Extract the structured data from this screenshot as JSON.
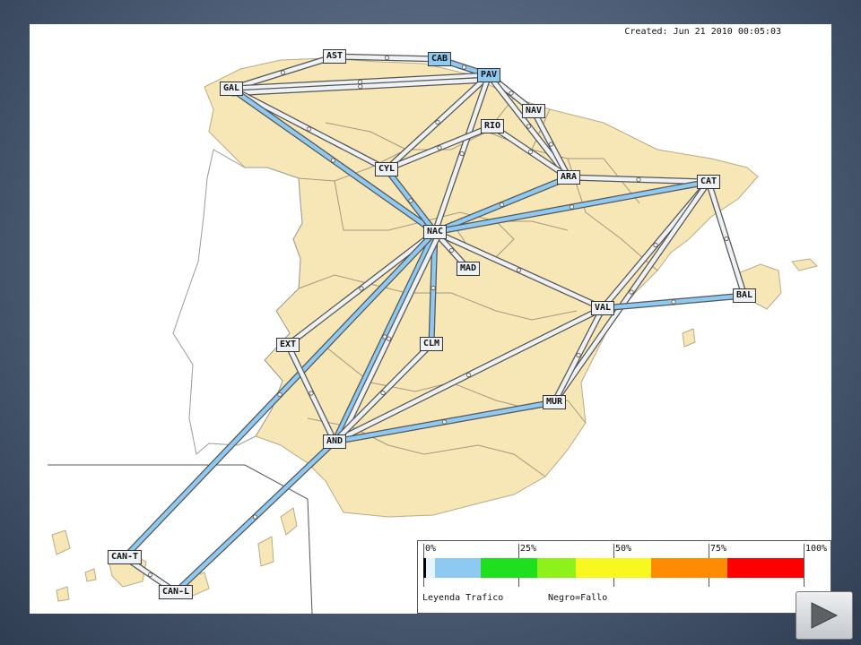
{
  "created": "Created: Jun 21 2010 00:05:03",
  "colors": {
    "land": "#f7e6b6",
    "portugal": "#ffffff",
    "link_low": "#eef2f4",
    "link_high": "#8ec9f2",
    "outline": "#333333"
  },
  "nodes": [
    {
      "id": "AST",
      "label": "AST",
      "style": "gray"
    },
    {
      "id": "CAB",
      "label": "CAB",
      "style": "blue"
    },
    {
      "id": "PAV",
      "label": "PAV",
      "style": "blue"
    },
    {
      "id": "GAL",
      "label": "GAL",
      "style": "gray"
    },
    {
      "id": "NAV",
      "label": "NAV",
      "style": "gray"
    },
    {
      "id": "RIO",
      "label": "RIO",
      "style": "gray"
    },
    {
      "id": "CYL",
      "label": "CYL",
      "style": "gray"
    },
    {
      "id": "ARA",
      "label": "ARA",
      "style": "gray"
    },
    {
      "id": "CAT",
      "label": "CAT",
      "style": "gray"
    },
    {
      "id": "NAC",
      "label": "NAC",
      "style": "gray"
    },
    {
      "id": "MAD",
      "label": "MAD",
      "style": "gray"
    },
    {
      "id": "BAL",
      "label": "BAL",
      "style": "gray"
    },
    {
      "id": "VAL",
      "label": "VAL",
      "style": "gray"
    },
    {
      "id": "EXT",
      "label": "EXT",
      "style": "gray"
    },
    {
      "id": "CLM",
      "label": "CLM",
      "style": "gray"
    },
    {
      "id": "MUR",
      "label": "MUR",
      "style": "gray"
    },
    {
      "id": "AND",
      "label": "AND",
      "style": "gray"
    },
    {
      "id": "CANT",
      "label": "CAN-T",
      "style": "gray"
    },
    {
      "id": "CANL",
      "label": "CAN-L",
      "style": "gray"
    }
  ],
  "links": [
    {
      "from": "GAL",
      "to": "AST",
      "load": "low"
    },
    {
      "from": "AST",
      "to": "CAB",
      "load": "low"
    },
    {
      "from": "CAB",
      "to": "PAV",
      "load": "high"
    },
    {
      "from": "GAL",
      "to": "PAV",
      "load": "low"
    },
    {
      "from": "GAL",
      "to": "PAV",
      "load": "low",
      "bend": 1
    },
    {
      "from": "GAL",
      "to": "CYL",
      "load": "low"
    },
    {
      "from": "GAL",
      "to": "NAC",
      "load": "high"
    },
    {
      "from": "PAV",
      "to": "CYL",
      "load": "low"
    },
    {
      "from": "PAV",
      "to": "NAV",
      "load": "low"
    },
    {
      "from": "PAV",
      "to": "NAC",
      "load": "low"
    },
    {
      "from": "PAV",
      "to": "ARA",
      "load": "low"
    },
    {
      "from": "NAV",
      "to": "ARA",
      "load": "low"
    },
    {
      "from": "RIO",
      "to": "ARA",
      "load": "low"
    },
    {
      "from": "RIO",
      "to": "CYL",
      "load": "low"
    },
    {
      "from": "CYL",
      "to": "NAC",
      "load": "high"
    },
    {
      "from": "ARA",
      "to": "CAT",
      "load": "low"
    },
    {
      "from": "ARA",
      "to": "NAC",
      "load": "high"
    },
    {
      "from": "CAT",
      "to": "NAC",
      "load": "high"
    },
    {
      "from": "CAT",
      "to": "BAL",
      "load": "low"
    },
    {
      "from": "CAT",
      "to": "VAL",
      "load": "low"
    },
    {
      "from": "CAT",
      "to": "MUR",
      "load": "low"
    },
    {
      "from": "NAC",
      "to": "MAD",
      "load": "low"
    },
    {
      "from": "NAC",
      "to": "VAL",
      "load": "low"
    },
    {
      "from": "NAC",
      "to": "EXT",
      "load": "low"
    },
    {
      "from": "NAC",
      "to": "CLM",
      "load": "high"
    },
    {
      "from": "NAC",
      "to": "AND",
      "load": "high"
    },
    {
      "from": "NAC",
      "to": "AND",
      "load": "low",
      "bend": -1
    },
    {
      "from": "NAC",
      "to": "CANT",
      "load": "high"
    },
    {
      "from": "VAL",
      "to": "BAL",
      "load": "high"
    },
    {
      "from": "VAL",
      "to": "MUR",
      "load": "low"
    },
    {
      "from": "VAL",
      "to": "AND",
      "load": "low"
    },
    {
      "from": "EXT",
      "to": "AND",
      "load": "low"
    },
    {
      "from": "CLM",
      "to": "AND",
      "load": "low"
    },
    {
      "from": "MUR",
      "to": "AND",
      "load": "high"
    },
    {
      "from": "AND",
      "to": "CANL",
      "load": "high"
    },
    {
      "from": "CANT",
      "to": "CANL",
      "load": "low"
    }
  ],
  "legend": {
    "ticks": [
      "0%",
      "25%",
      "50%",
      "75%",
      "100%"
    ],
    "title": "Leyenda Trafico",
    "fail": "Negro=Fallo",
    "bands": [
      {
        "from": 0,
        "to": 0.6,
        "color": "#000000"
      },
      {
        "from": 0.6,
        "to": 3,
        "color": "#e6f4fc"
      },
      {
        "from": 3,
        "to": 15,
        "color": "#8ec9f2"
      },
      {
        "from": 15,
        "to": 30,
        "color": "#1ee01e"
      },
      {
        "from": 30,
        "to": 40,
        "color": "#8ef21a"
      },
      {
        "from": 40,
        "to": 60,
        "color": "#f8f820"
      },
      {
        "from": 60,
        "to": 80,
        "color": "#ff8c00"
      },
      {
        "from": 80,
        "to": 100,
        "color": "#ff0000"
      }
    ]
  },
  "controls": {
    "next_icon": "play-arrow-icon"
  }
}
